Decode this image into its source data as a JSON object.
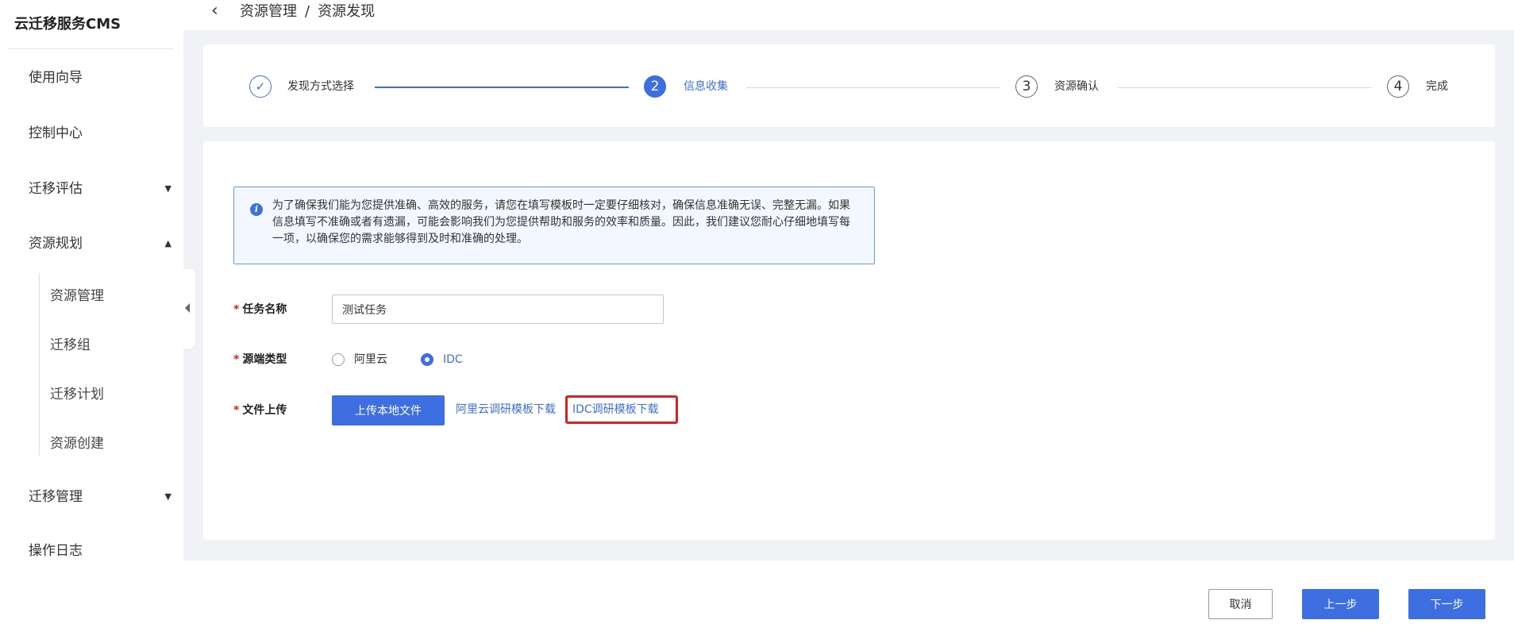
{
  "sidebar": {
    "brand": "云迁移服务CMS",
    "items": [
      {
        "label": "使用向导"
      },
      {
        "label": "控制中心"
      },
      {
        "label": "迁移评估"
      },
      {
        "label": "资源规划"
      },
      {
        "label": "迁移管理"
      },
      {
        "label": "操作日志"
      }
    ],
    "subitems": [
      {
        "label": "资源管理"
      },
      {
        "label": "迁移组"
      },
      {
        "label": "迁移计划"
      },
      {
        "label": "资源创建"
      }
    ]
  },
  "header": {
    "breadcrumb": [
      "资源管理",
      "/",
      "资源发现"
    ]
  },
  "steps": [
    {
      "number": "✓",
      "label": "发现方式选择",
      "state": "done"
    },
    {
      "number": "2",
      "label": "信息收集",
      "state": "active"
    },
    {
      "number": "3",
      "label": "资源确认",
      "state": "pending"
    },
    {
      "number": "4",
      "label": "完成",
      "state": "pending"
    }
  ],
  "notice": {
    "text": "为了确保我们能为您提供准确、高效的服务，请您在填写模板时一定要仔细核对，确保信息准确无误、完整无漏。如果信息填写不准确或者有遗漏，可能会影响我们为您提供帮助和服务的效率和质量。因此，我们建议您耐心仔细地填写每一项，以确保您的需求能够得到及时和准确的处理。"
  },
  "form": {
    "required_mark": "*",
    "task_name": {
      "label": "任务名称",
      "value": "测试任务"
    },
    "source_type": {
      "label": "源端类型",
      "options": [
        "阿里云",
        "IDC"
      ],
      "selected": "IDC"
    },
    "file_upload": {
      "label": "文件上传",
      "button": "上传本地文件",
      "link_aliyun": "阿里云调研模板下载",
      "link_idc": "IDC调研模板下载"
    }
  },
  "footer": {
    "cancel": "取消",
    "prev": "上一步",
    "next": "下一步"
  },
  "colors": {
    "primary": "#3d6fe0",
    "highlight": "#e02020"
  }
}
